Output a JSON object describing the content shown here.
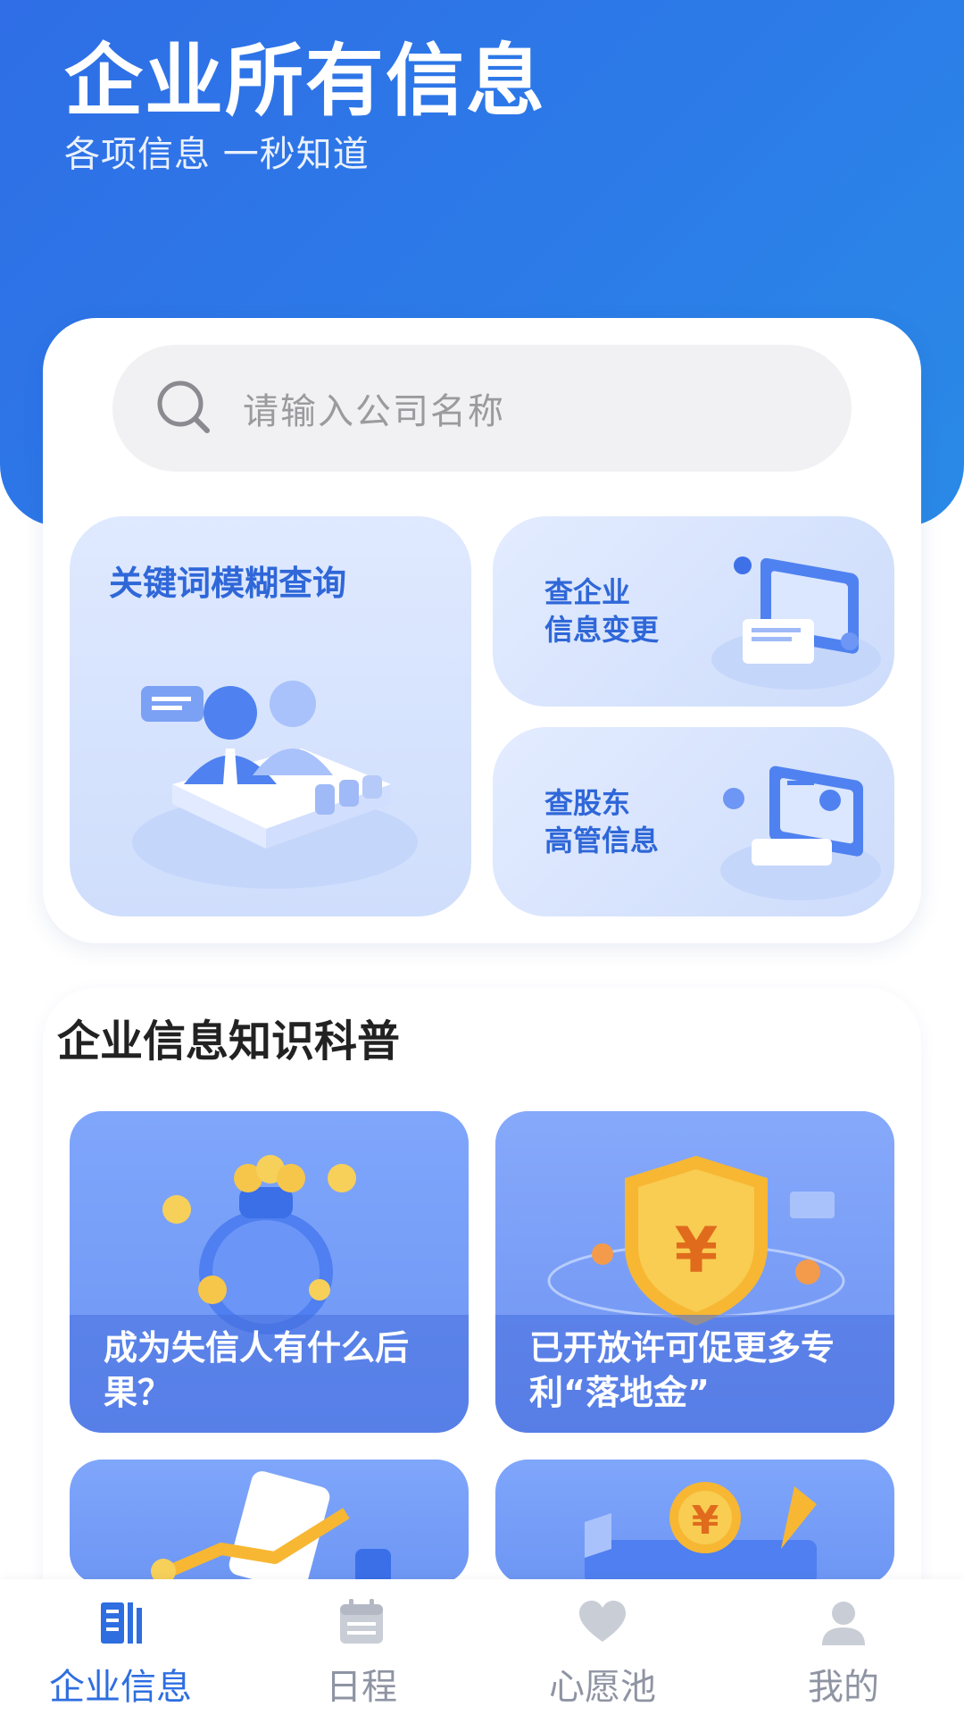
{
  "hero": {
    "title": "企业所有信息",
    "subtitle": "各项信息 一秒知道"
  },
  "search": {
    "placeholder": "请输入公司名称",
    "icon": "search-icon"
  },
  "features": [
    {
      "label": "关键词模糊查询",
      "icon": "people-illustration"
    },
    {
      "label_line1": "查企业",
      "label_line2": "信息变更",
      "icon": "document-change-illustration"
    },
    {
      "label_line1": "查股东",
      "label_line2": "高管信息",
      "icon": "certificate-illustration"
    }
  ],
  "knowledge": {
    "title": "企业信息知识科普",
    "articles": [
      {
        "title": "成为失信人有什么后果？",
        "icon": "money-bag-illustration"
      },
      {
        "title": "已开放许可促更多专利“落地金”",
        "icon": "shield-yuan-illustration"
      },
      {
        "title": "",
        "icon": "growth-chart-illustration"
      },
      {
        "title": "",
        "icon": "yuan-coin-illustration"
      }
    ]
  },
  "tabbar": {
    "items": [
      {
        "label": "企业信息",
        "icon": "building-icon",
        "active": true
      },
      {
        "label": "日程",
        "icon": "calendar-icon",
        "active": false
      },
      {
        "label": "心愿池",
        "icon": "heart-icon",
        "active": false
      },
      {
        "label": "我的",
        "icon": "user-icon",
        "active": false
      }
    ]
  },
  "colors": {
    "brand": "#2f6ee6",
    "tab_active": "#2e6ee0",
    "tab_inactive": "#8f94a3"
  }
}
